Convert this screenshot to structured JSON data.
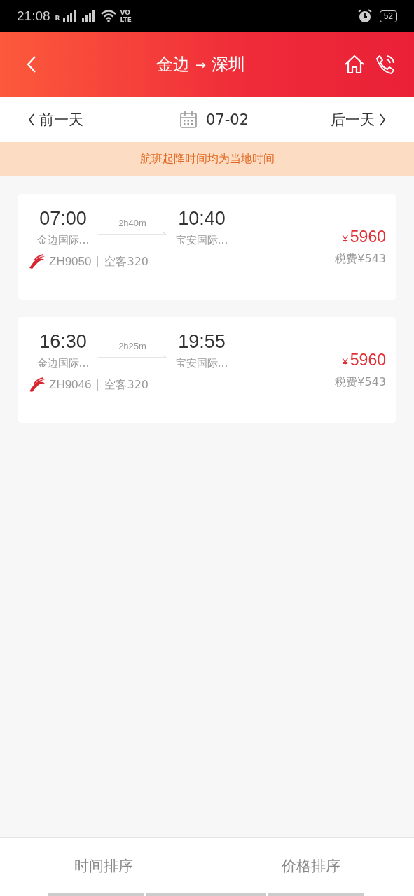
{
  "status_bar": {
    "time": "21:08",
    "roaming": "R",
    "volte_top": "VO",
    "volte_bottom": "LTE",
    "battery": "52"
  },
  "header": {
    "from": "金边",
    "arrow": "→",
    "to": "深圳"
  },
  "date_bar": {
    "prev": "前一天",
    "date": "07-02",
    "next": "后一天"
  },
  "notice": "航班起降时间均为当地时间",
  "flights": [
    {
      "depart_time": "07:00",
      "duration": "2h40m",
      "arrive_time": "10:40",
      "depart_airport": "金边国际…",
      "arrive_airport": "宝安国际…",
      "flight_no": "ZH9050",
      "aircraft": "空客320",
      "currency": "¥",
      "price": "5960",
      "tax": "税费¥543"
    },
    {
      "depart_time": "16:30",
      "duration": "2h25m",
      "arrive_time": "19:55",
      "depart_airport": "金边国际…",
      "arrive_airport": "宝安国际…",
      "flight_no": "ZH9046",
      "aircraft": "空客320",
      "currency": "¥",
      "price": "5960",
      "tax": "税费¥543"
    }
  ],
  "sort_buttons": [
    "时间排序",
    "价格排序"
  ]
}
